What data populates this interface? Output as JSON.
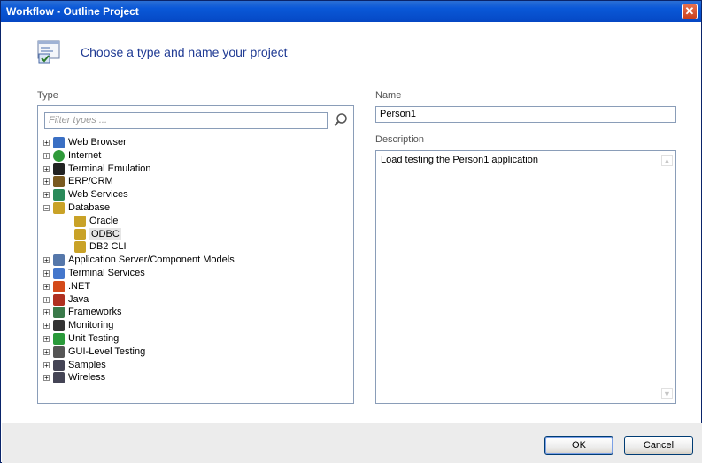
{
  "window": {
    "title": "Workflow - Outline Project",
    "close_glyph": "✕"
  },
  "header": {
    "heading": "Choose a type and name your project",
    "icon": "project-wizard-icon"
  },
  "type_panel": {
    "label": "Type",
    "filter_placeholder": "Filter types ...",
    "tree": [
      {
        "label": "Web Browser",
        "icon": "browser-icon",
        "expander": "+",
        "level": 0
      },
      {
        "label": "Internet",
        "icon": "globe-icon",
        "expander": "+",
        "level": 0
      },
      {
        "label": "Terminal Emulation",
        "icon": "terminal-icon",
        "expander": "+",
        "level": 0
      },
      {
        "label": "ERP/CRM",
        "icon": "erp-icon",
        "expander": "+",
        "level": 0
      },
      {
        "label": "Web Services",
        "icon": "web-services-icon",
        "expander": "+",
        "level": 0
      },
      {
        "label": "Database",
        "icon": "database-icon",
        "expander": "−",
        "level": 0
      },
      {
        "label": "Oracle",
        "icon": "db-icon",
        "expander": "",
        "level": 1
      },
      {
        "label": "ODBC",
        "icon": "db-icon",
        "expander": "",
        "level": 1,
        "selected": true
      },
      {
        "label": "DB2 CLI",
        "icon": "db-icon",
        "expander": "",
        "level": 1
      },
      {
        "label": "Application Server/Component Models",
        "icon": "app-server-icon",
        "expander": "+",
        "level": 0
      },
      {
        "label": "Terminal Services",
        "icon": "terminal-services-icon",
        "expander": "+",
        "level": 0
      },
      {
        "label": ".NET",
        "icon": "dotnet-icon",
        "expander": "+",
        "level": 0
      },
      {
        "label": "Java",
        "icon": "java-icon",
        "expander": "+",
        "level": 0
      },
      {
        "label": "Frameworks",
        "icon": "frameworks-icon",
        "expander": "+",
        "level": 0
      },
      {
        "label": "Monitoring",
        "icon": "monitoring-icon",
        "expander": "+",
        "level": 0
      },
      {
        "label": "Unit Testing",
        "icon": "unit-testing-icon",
        "expander": "+",
        "level": 0
      },
      {
        "label": "GUI-Level Testing",
        "icon": "gui-testing-icon",
        "expander": "+",
        "level": 0
      },
      {
        "label": "Samples",
        "icon": "samples-icon",
        "expander": "+",
        "level": 0
      },
      {
        "label": "Wireless",
        "icon": "wireless-icon",
        "expander": "+",
        "level": 0
      }
    ]
  },
  "name_field": {
    "label": "Name",
    "value": "Person1"
  },
  "description_field": {
    "label": "Description",
    "value": "Load testing the Person1 application"
  },
  "footer": {
    "ok_label": "OK",
    "cancel_label": "Cancel"
  },
  "colors": {
    "title_bar": "#0548c4",
    "heading": "#1f3a93",
    "footer_bg": "#ececec",
    "close_button": "#c8401e"
  }
}
